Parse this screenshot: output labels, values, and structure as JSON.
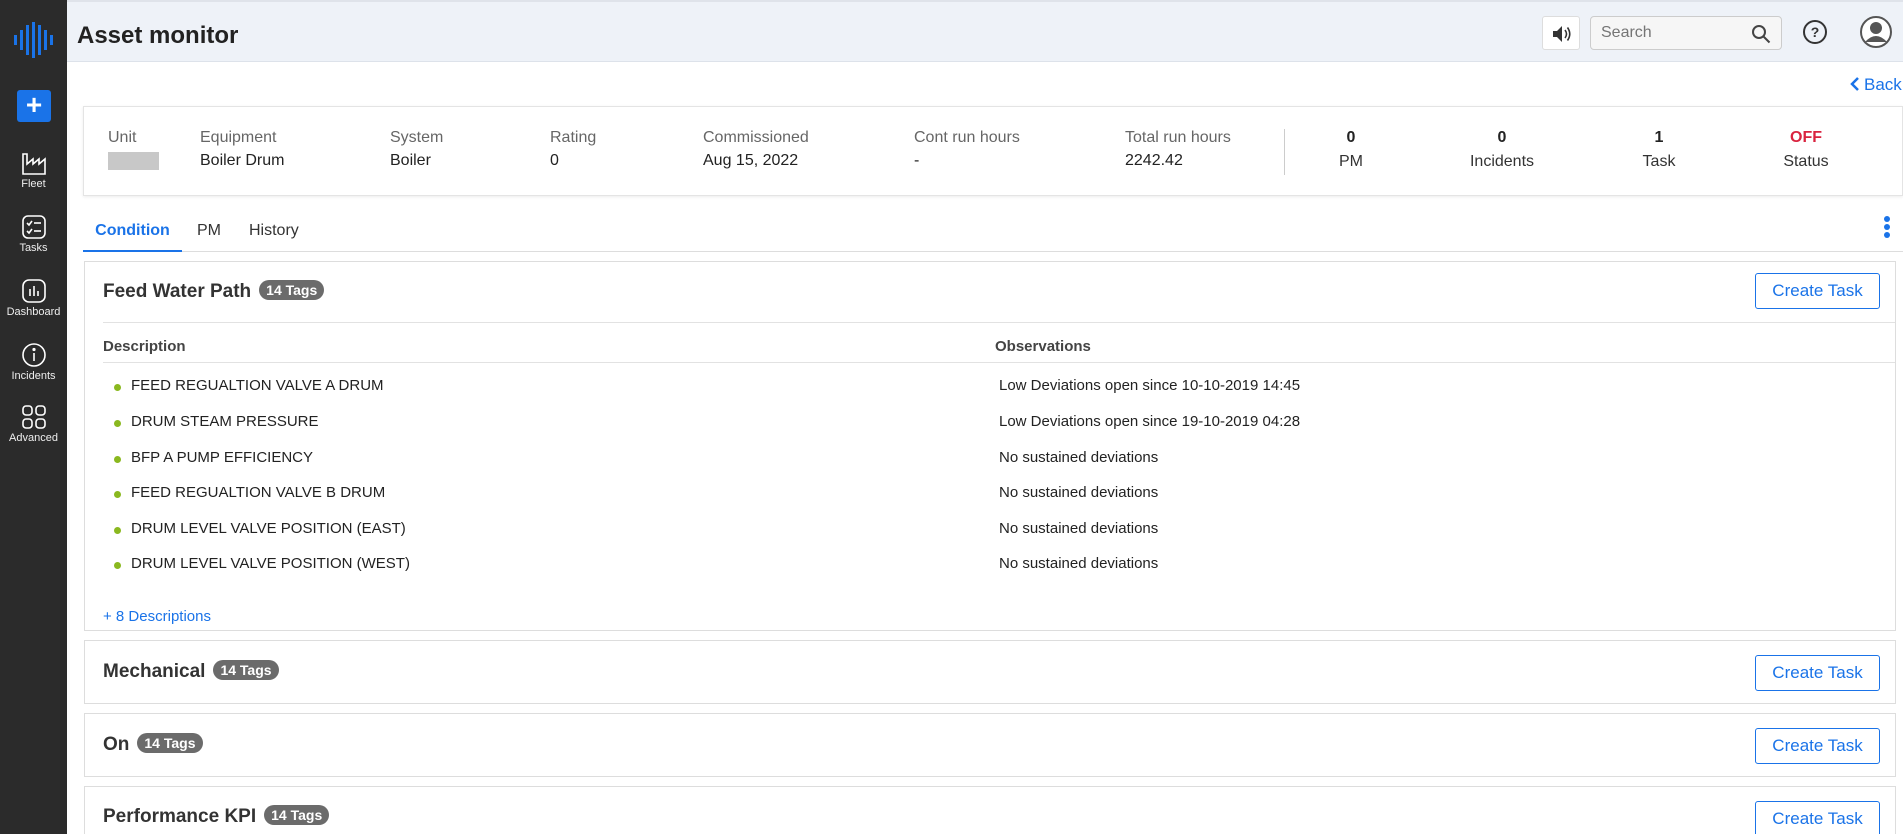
{
  "sidebar": {
    "add_label": "+",
    "items": [
      {
        "label": "Fleet",
        "icon": "factory-icon"
      },
      {
        "label": "Tasks",
        "icon": "checklist-icon"
      },
      {
        "label": "Dashboard",
        "icon": "chart-icon"
      },
      {
        "label": "Incidents",
        "icon": "info-icon"
      },
      {
        "label": "Advanced",
        "icon": "grid-icon"
      }
    ]
  },
  "header": {
    "title": "Asset monitor",
    "search_placeholder": "Search"
  },
  "back_label": "Back",
  "info": {
    "unit_label": "Unit",
    "equipment_label": "Equipment",
    "equipment_value": "Boiler Drum",
    "system_label": "System",
    "system_value": "Boiler",
    "rating_label": "Rating",
    "rating_value": "0",
    "commissioned_label": "Commissioned",
    "commissioned_value": "Aug 15, 2022",
    "cont_label": "Cont run hours",
    "cont_value": "-",
    "total_label": "Total run hours",
    "total_value": "2242.42",
    "stats": [
      {
        "value": "0",
        "label": "PM"
      },
      {
        "value": "0",
        "label": "Incidents"
      },
      {
        "value": "1",
        "label": "Task"
      },
      {
        "value": "OFF",
        "label": "Status"
      }
    ]
  },
  "tabs": [
    "Condition",
    "PM",
    "History"
  ],
  "sections": [
    {
      "title": "Feed Water Path",
      "badge": "14 Tags",
      "button": "Create Task",
      "col_description": "Description",
      "col_observations": "Observations",
      "rows": [
        {
          "description": "FEED REGUALTION VALVE A DRUM",
          "observation": "Low Deviations open since 10-10-2019 14:45"
        },
        {
          "description": "DRUM STEAM PRESSURE",
          "observation": "Low Deviations open since 19-10-2019 04:28"
        },
        {
          "description": "BFP A PUMP EFFICIENCY",
          "observation": "No sustained deviations"
        },
        {
          "description": "FEED REGUALTION VALVE B DRUM",
          "observation": "No sustained deviations"
        },
        {
          "description": "DRUM LEVEL VALVE POSITION (EAST)",
          "observation": "No sustained deviations"
        },
        {
          "description": "DRUM LEVEL VALVE POSITION (WEST)",
          "observation": "No sustained deviations"
        }
      ],
      "more": "+ 8 Descriptions"
    },
    {
      "title": "Mechanical",
      "badge": "14 Tags",
      "button": "Create Task"
    },
    {
      "title": "On",
      "badge": "14 Tags",
      "button": "Create Task"
    },
    {
      "title": "Performance KPI",
      "badge": "14 Tags",
      "button": "Create Task"
    }
  ],
  "colors": {
    "accent": "#1a73e8",
    "sidebar": "#2b2b2b",
    "status_off": "#d9233f",
    "dot": "#8ab81f"
  }
}
